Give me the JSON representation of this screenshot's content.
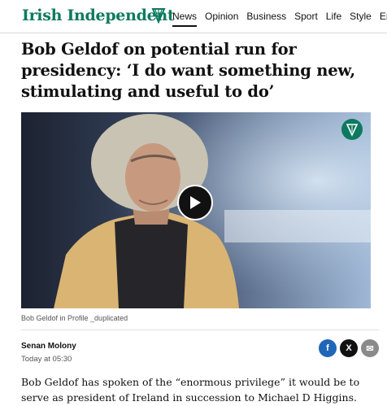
{
  "brand": {
    "name": "Irish Independent"
  },
  "nav": [
    "News",
    "Opinion",
    "Business",
    "Sport",
    "Life",
    "Style",
    "Entert"
  ],
  "article": {
    "headline": "Bob Geldof on potential run for presidency: ‘I do want something new, stimulating and useful to do’",
    "caption": "Bob Geldof in Profile _duplicated",
    "author": "Senan Molony",
    "date": "Today at 05:30",
    "body": "Bob Geldof has spoken of the “enormous privilege” it would be to serve as president of Ireland in succession to Michael D Higgins."
  },
  "share": {
    "facebook": "f",
    "x": "X",
    "email": "✉"
  },
  "colors": {
    "brand": "#0d7a5f",
    "facebook": "#1f66b8"
  },
  "icons": [
    "harp-icon",
    "play-icon",
    "facebook-icon",
    "x-icon",
    "email-icon"
  ]
}
